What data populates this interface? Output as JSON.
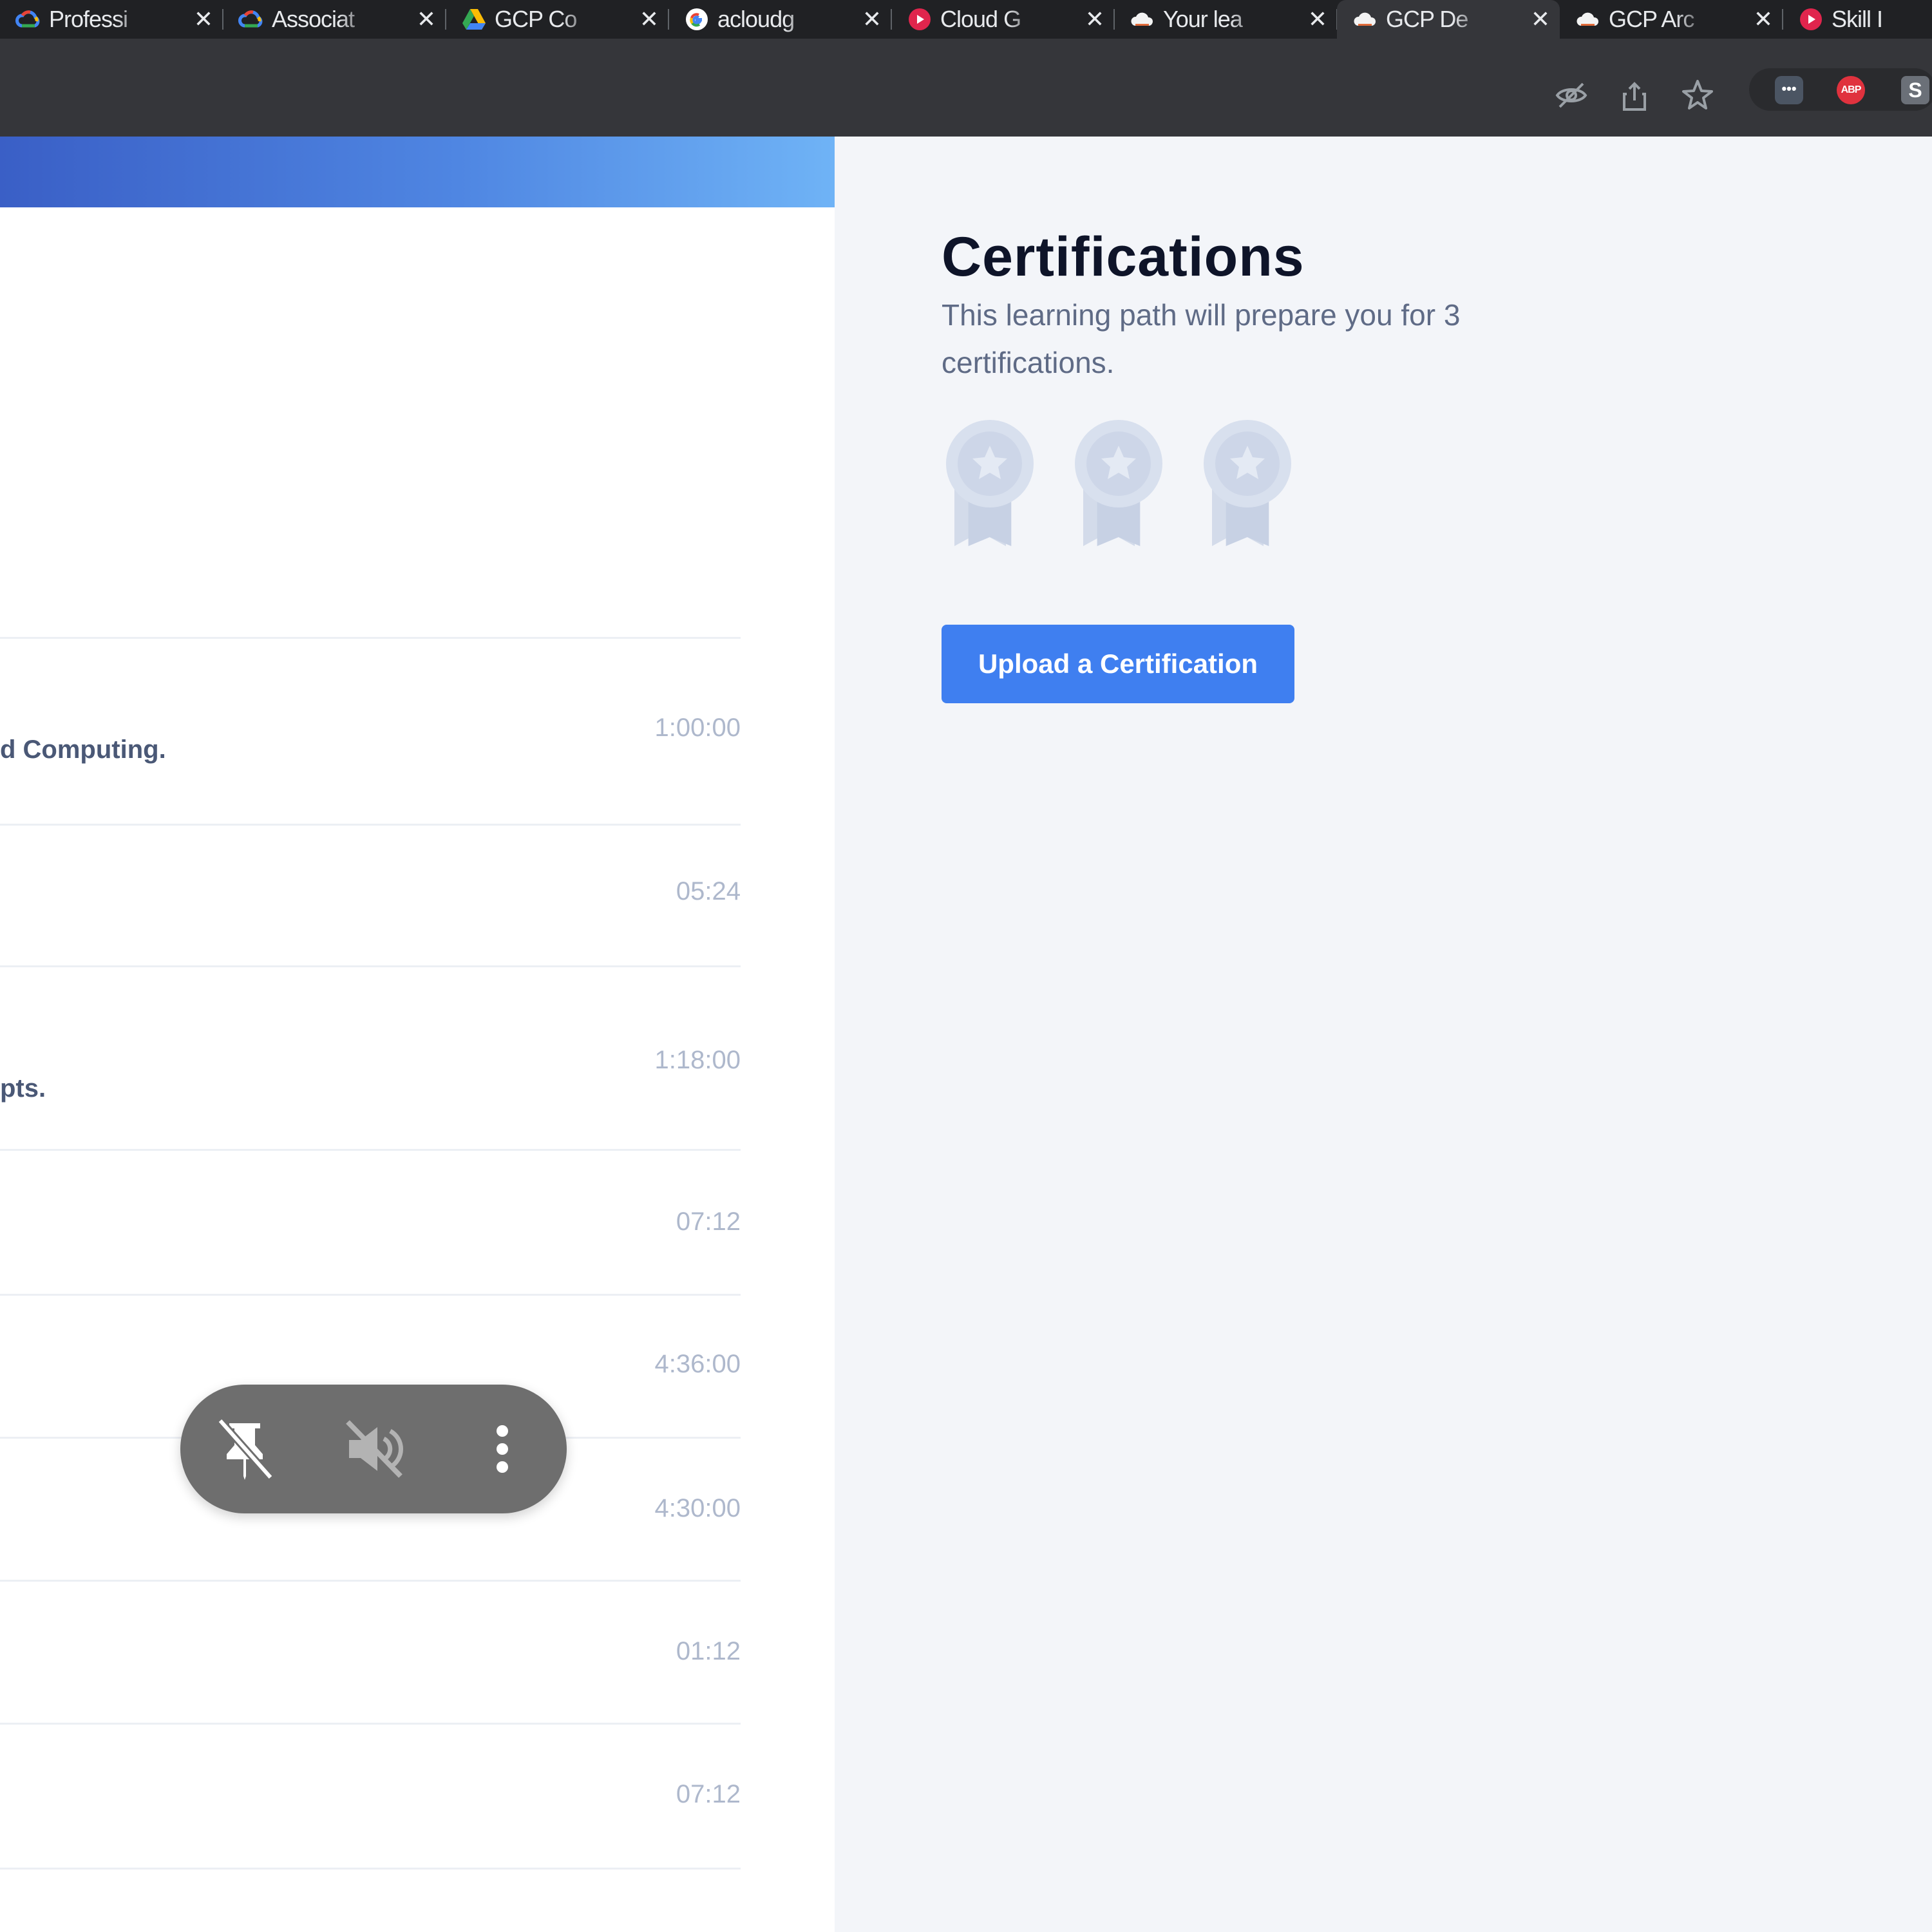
{
  "browser": {
    "tabs": [
      {
        "icon": "google-cloud-icon",
        "title": "Professi",
        "active": false
      },
      {
        "icon": "google-cloud-icon",
        "title": "Associat",
        "active": false
      },
      {
        "icon": "google-drive-icon",
        "title": "GCP Co",
        "active": false
      },
      {
        "icon": "google-g-icon",
        "title": "acloudg",
        "active": false
      },
      {
        "icon": "acloudguru-icon",
        "title": "Cloud G",
        "active": false
      },
      {
        "icon": "cloud-icon",
        "title": "Your lea",
        "active": false
      },
      {
        "icon": "cloud-icon",
        "title": "GCP De",
        "active": true
      },
      {
        "icon": "cloud-icon",
        "title": "GCP Arc",
        "active": false
      },
      {
        "icon": "acloudguru-icon",
        "title": "Skill I",
        "active": false
      }
    ],
    "close_glyph": "✕",
    "extensions": {
      "more_label": "•••",
      "adblock_label": "ABP",
      "s_label": "S"
    }
  },
  "course_rows": [
    {
      "description": "",
      "duration": ""
    },
    {
      "description": "d Computing.",
      "duration": "1:00:00"
    },
    {
      "description": "",
      "duration": "05:24"
    },
    {
      "description": "pts.",
      "duration": "1:18:00"
    },
    {
      "description": "",
      "duration": "07:12"
    },
    {
      "description": "",
      "duration": "4:36:00"
    },
    {
      "description": "",
      "duration": "4:30:00"
    },
    {
      "description": "",
      "duration": "01:12"
    },
    {
      "description": "",
      "duration": "07:12"
    }
  ],
  "certifications": {
    "title": "Certifications",
    "description": "This learning path will prepare you for 3 certifications.",
    "medal_count": 3,
    "upload_label": "Upload a Certification"
  },
  "media_controls": [
    "unpin-icon",
    "mute-icon",
    "more-vert-icon"
  ],
  "colors": {
    "accent_blue": "#3f7ff0",
    "hero_gradient_start": "#3a5fc6",
    "hero_gradient_end": "#6fb3f6",
    "medal": "#cfd8e8"
  }
}
